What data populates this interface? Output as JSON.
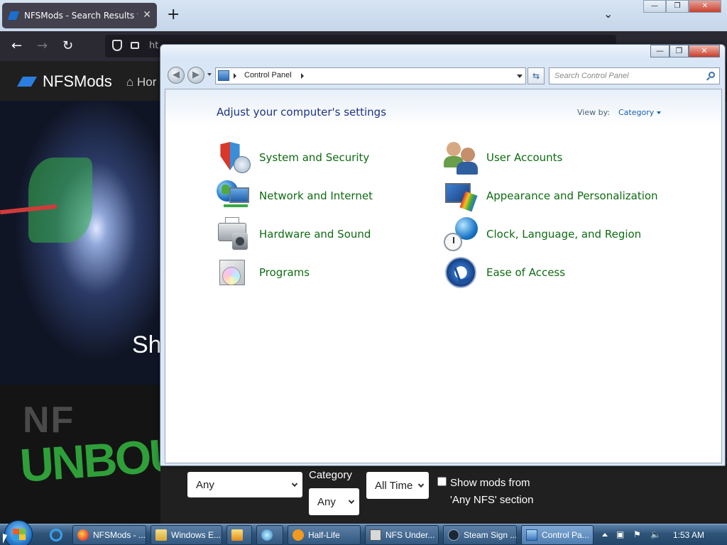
{
  "browser": {
    "tab_title": "NFSMods - Search Results for w",
    "tab_close": "✕",
    "new_tab": "+",
    "list_all_tabs": "⌄",
    "url": "ht",
    "win_min": "—",
    "win_max": "❐",
    "win_close": "✕"
  },
  "site": {
    "logo": "NFSMods",
    "nav_home": "Hor",
    "hero_text": "Sh",
    "promo_big": "NF",
    "promo_graffiti": "UNBOU"
  },
  "filters": {
    "select1_value": "Any",
    "category_label": "Category",
    "category_value": "Any",
    "time_value": "All Time",
    "show_mods_label": "Show mods from 'Any NFS' section"
  },
  "control_panel": {
    "address_crumb": "Control Panel",
    "search_placeholder": "Search Control Panel",
    "heading": "Adjust your computer's settings",
    "view_by_label": "View by:",
    "view_by_value": "Category",
    "win_min": "—",
    "win_max": "❐",
    "win_close": "✕",
    "categories": [
      {
        "label": "System and Security",
        "icon": "shield-icon"
      },
      {
        "label": "User Accounts",
        "icon": "users-icon"
      },
      {
        "label": "Network and Internet",
        "icon": "network-globe-icon"
      },
      {
        "label": "Appearance and Personalization",
        "icon": "monitor-paintbrush-icon"
      },
      {
        "label": "Hardware and Sound",
        "icon": "printer-speaker-icon"
      },
      {
        "label": "Clock, Language, and Region",
        "icon": "clock-globe-icon"
      },
      {
        "label": "Programs",
        "icon": "programs-box-icon"
      },
      {
        "label": "Ease of Access",
        "icon": "ease-of-access-icon"
      }
    ]
  },
  "taskbar": {
    "items": [
      {
        "label": "NFSMods - ..."
      },
      {
        "label": "Windows E..."
      },
      {
        "label": "Half-Life"
      },
      {
        "label": "NFS Under..."
      },
      {
        "label": "Steam Sign ..."
      },
      {
        "label": "Control Pa..."
      }
    ],
    "clock": "1:53 AM"
  }
}
